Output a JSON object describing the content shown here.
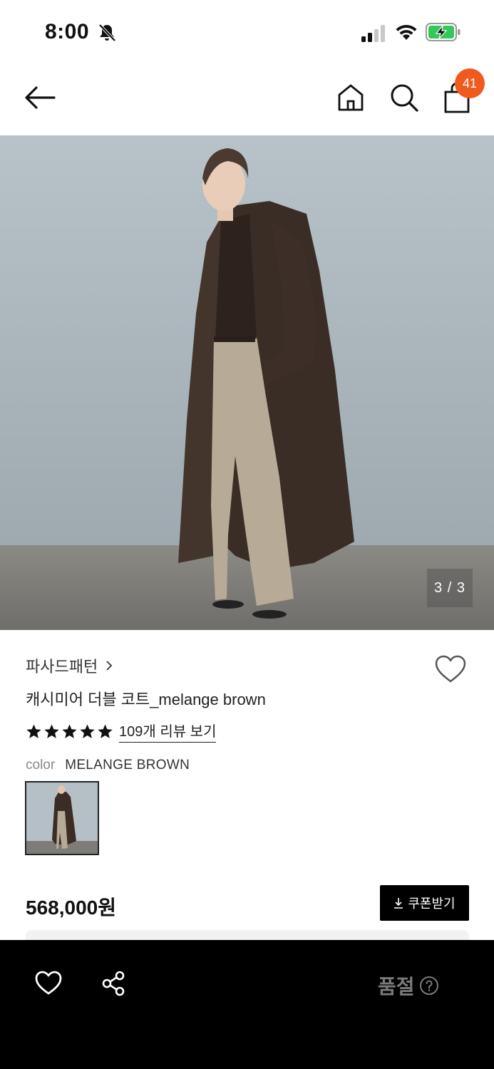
{
  "status_bar": {
    "time": "8:00"
  },
  "header": {
    "cart_count": "41"
  },
  "product_image": {
    "counter": "3 / 3"
  },
  "product": {
    "brand": "파사드패턴",
    "name": "캐시미어 더블 코트_melange brown",
    "rating_stars": 5,
    "review_link": "109개 리뷰 보기",
    "color_label": "color",
    "color_value": "MELANGE BROWN",
    "price": "568,000원",
    "coupon_label": "쿠폰받기"
  },
  "bottom_bar": {
    "status_label": "품절"
  },
  "colors": {
    "badge": "#f05a1e",
    "bottom_bar": "#000000",
    "soldout_text": "#7a7a7a"
  }
}
